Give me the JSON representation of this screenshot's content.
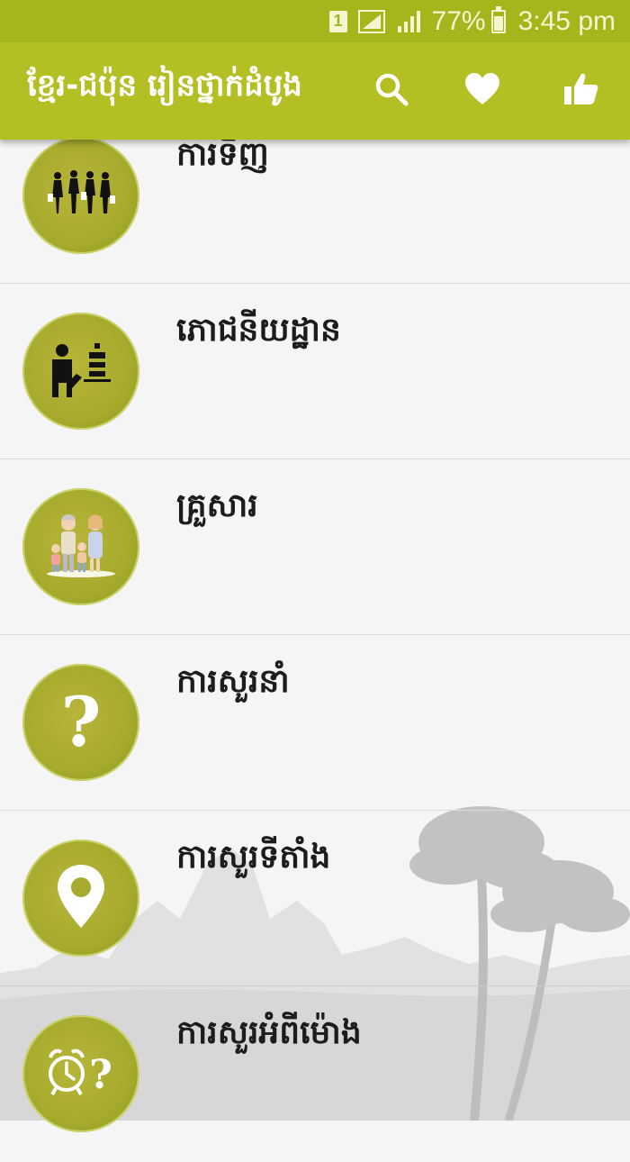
{
  "status_bar": {
    "sim": "1",
    "battery": "77%",
    "time": "3:45 pm"
  },
  "app_bar": {
    "title": "ខ្មែរ-ជប៉ុន រៀនថ្នាក់ដំបូង",
    "actions": [
      "search-icon",
      "heart-icon",
      "thumbs-up-icon"
    ]
  },
  "categories": [
    {
      "label": "ការទិញ",
      "icon": "shopping-people-icon"
    },
    {
      "label": "ភោជនីយដ្ឋាន",
      "icon": "waiter-icon"
    },
    {
      "label": "គ្រួសារ",
      "icon": "family-icon"
    },
    {
      "label": "ការសួរនាំ",
      "icon": "question-mark-icon"
    },
    {
      "label": "ការសួរទីតាំង",
      "icon": "location-pin-icon"
    },
    {
      "label": "ការសួរអំពីម៉ោង",
      "icon": "alarm-clock-question-icon"
    }
  ],
  "colors": {
    "status_bar": "#a7b51c",
    "app_bar": "#b3bf22",
    "circle": "#a6aa2d",
    "background": "#f5f5f5"
  }
}
